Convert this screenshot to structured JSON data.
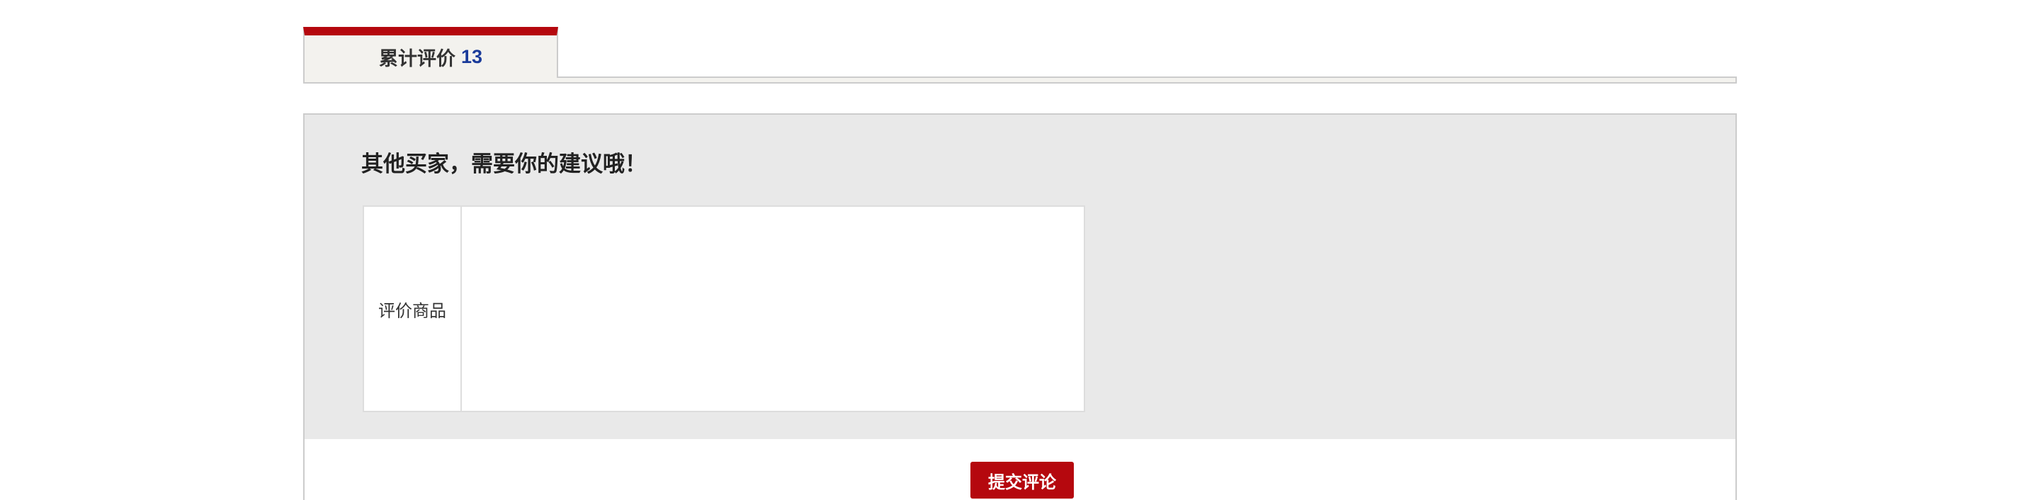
{
  "tabs": [
    {
      "label": "累计评价",
      "count": "13"
    }
  ],
  "review": {
    "title": "其他买家，需要你的建议哦！",
    "product_label": "评价商品"
  },
  "actions": {
    "submit_label": "提交评论"
  },
  "colors": {
    "accent": "#b5080e",
    "count": "#1a3b9a",
    "panel_bg": "#e9e9e9",
    "tab_bg": "#f3f2ee"
  }
}
